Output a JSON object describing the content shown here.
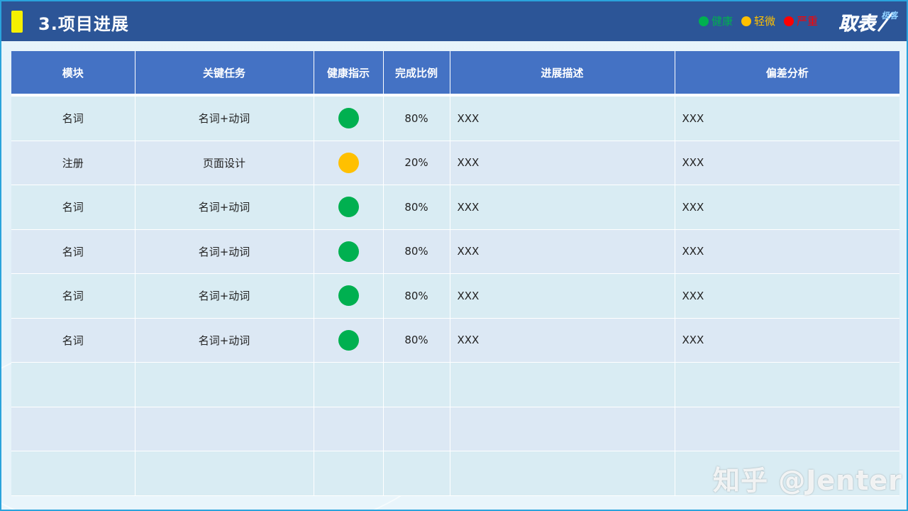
{
  "header": {
    "title": "3.项目进展"
  },
  "legend": [
    {
      "label": "健康",
      "color": "#00b050"
    },
    {
      "label": "轻微",
      "color": "#ffc000"
    },
    {
      "label": "严重",
      "color": "#ff0000"
    }
  ],
  "logo": {
    "text_main": "取表",
    "text_badge": "极客"
  },
  "table": {
    "columns": [
      "模块",
      "关键任务",
      "健康指示",
      "完成比例",
      "进展描述",
      "偏差分析"
    ],
    "rows": [
      {
        "module": "名词",
        "task": "名词+动词",
        "health": "green",
        "percent": "80%",
        "desc": "XXX",
        "analysis": "XXX"
      },
      {
        "module": "注册",
        "task": "页面设计",
        "health": "yellow",
        "percent": "20%",
        "desc": "XXX",
        "analysis": "XXX"
      },
      {
        "module": "名词",
        "task": "名词+动词",
        "health": "green",
        "percent": "80%",
        "desc": "XXX",
        "analysis": "XXX"
      },
      {
        "module": "名词",
        "task": "名词+动词",
        "health": "green",
        "percent": "80%",
        "desc": "XXX",
        "analysis": "XXX"
      },
      {
        "module": "名词",
        "task": "名词+动词",
        "health": "green",
        "percent": "80%",
        "desc": "XXX",
        "analysis": "XXX"
      },
      {
        "module": "名词",
        "task": "名词+动词",
        "health": "green",
        "percent": "80%",
        "desc": "XXX",
        "analysis": "XXX"
      },
      {
        "module": "",
        "task": "",
        "health": "",
        "percent": "",
        "desc": "",
        "analysis": ""
      },
      {
        "module": "",
        "task": "",
        "health": "",
        "percent": "",
        "desc": "",
        "analysis": ""
      },
      {
        "module": "",
        "task": "",
        "health": "",
        "percent": "",
        "desc": "",
        "analysis": ""
      }
    ],
    "health_colors": {
      "green": "#00b050",
      "yellow": "#ffc000",
      "red": "#ff0000"
    }
  },
  "watermark": "知乎 @Jenter"
}
